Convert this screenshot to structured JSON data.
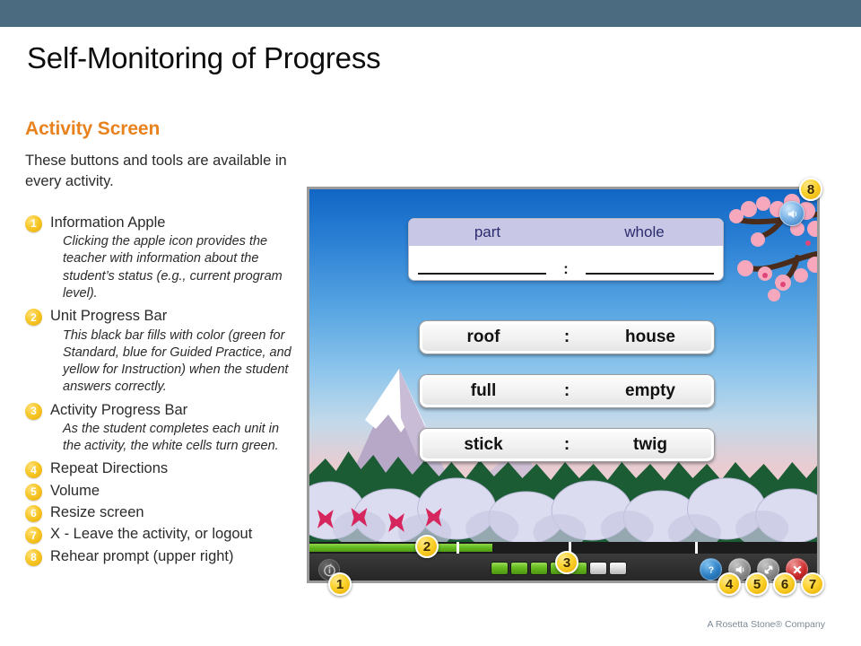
{
  "slide": {
    "title": "Self-Monitoring of Progress",
    "top_bar_color": "#4a6b80",
    "footer_note": "A Rosetta Stone® Company"
  },
  "left_column": {
    "heading": "Activity Screen",
    "heading_color": "#e8821e",
    "intro": "These buttons and tools are available in every activity.",
    "items": [
      {
        "num": "1",
        "title": "Information Apple",
        "desc": "Clicking the apple icon provides the teacher with information about the student’s status (e.g., current program level)."
      },
      {
        "num": "2",
        "title": "Unit Progress Bar",
        "desc": "This black bar fills with color (green for Standard, blue for Guided Practice, and yellow for Instruction) when the student answers correctly."
      },
      {
        "num": "3",
        "title": "Activity Progress Bar",
        "desc": "As the student completes each unit in the activity, the white cells turn green."
      },
      {
        "num": "4",
        "title": "Repeat Directions",
        "desc": ""
      },
      {
        "num": "5",
        "title": "Volume",
        "desc": ""
      },
      {
        "num": "6",
        "title": "Resize screen",
        "desc": ""
      },
      {
        "num": "7",
        "title": "X - Leave the activity, or logout",
        "desc": ""
      },
      {
        "num": "8",
        "title": "Rehear prompt (upper right)",
        "desc": ""
      }
    ]
  },
  "activity_screen": {
    "question": {
      "header_left": "part",
      "header_right": "whole",
      "separator": ":",
      "header_bg": "#c8c8e6",
      "header_text_color": "#2b2b6e"
    },
    "choices": [
      {
        "left": "roof",
        "sep": ":",
        "right": "house"
      },
      {
        "left": "full",
        "sep": ":",
        "right": "empty"
      },
      {
        "left": "stick",
        "sep": ":",
        "right": "twig"
      }
    ],
    "unit_progress": {
      "fill_percent": 36,
      "fill_color": "#63b81e",
      "track_color": "#1c1c1c",
      "ticks_percent": [
        29,
        51,
        76
      ]
    },
    "activity_progress": {
      "total_cells": 7,
      "completed_cells": 5,
      "done_color": "#66bb1f",
      "todo_color": "#dcdcdc"
    },
    "toolbar": {
      "info_apple": "info-apple-button",
      "buttons": [
        {
          "name": "repeat-directions",
          "icon": "question-mark-icon",
          "color": "#2d7fc4"
        },
        {
          "name": "volume",
          "icon": "speaker-icon",
          "color": "#8d8d8d"
        },
        {
          "name": "resize-screen",
          "icon": "resize-arrow-icon",
          "color": "#8d8d8d"
        },
        {
          "name": "exit",
          "icon": "close-x-icon",
          "color": "#cf2b2b"
        }
      ]
    },
    "rehear_prompt": {
      "icon": "speaker-icon",
      "color": "#2d74bb"
    },
    "callouts": [
      {
        "num": "1",
        "target": "info-apple"
      },
      {
        "num": "2",
        "target": "unit-progress-bar"
      },
      {
        "num": "3",
        "target": "activity-progress-bar"
      },
      {
        "num": "4",
        "target": "repeat-directions"
      },
      {
        "num": "5",
        "target": "volume"
      },
      {
        "num": "6",
        "target": "resize-screen"
      },
      {
        "num": "7",
        "target": "exit"
      },
      {
        "num": "8",
        "target": "rehear-prompt"
      }
    ]
  }
}
